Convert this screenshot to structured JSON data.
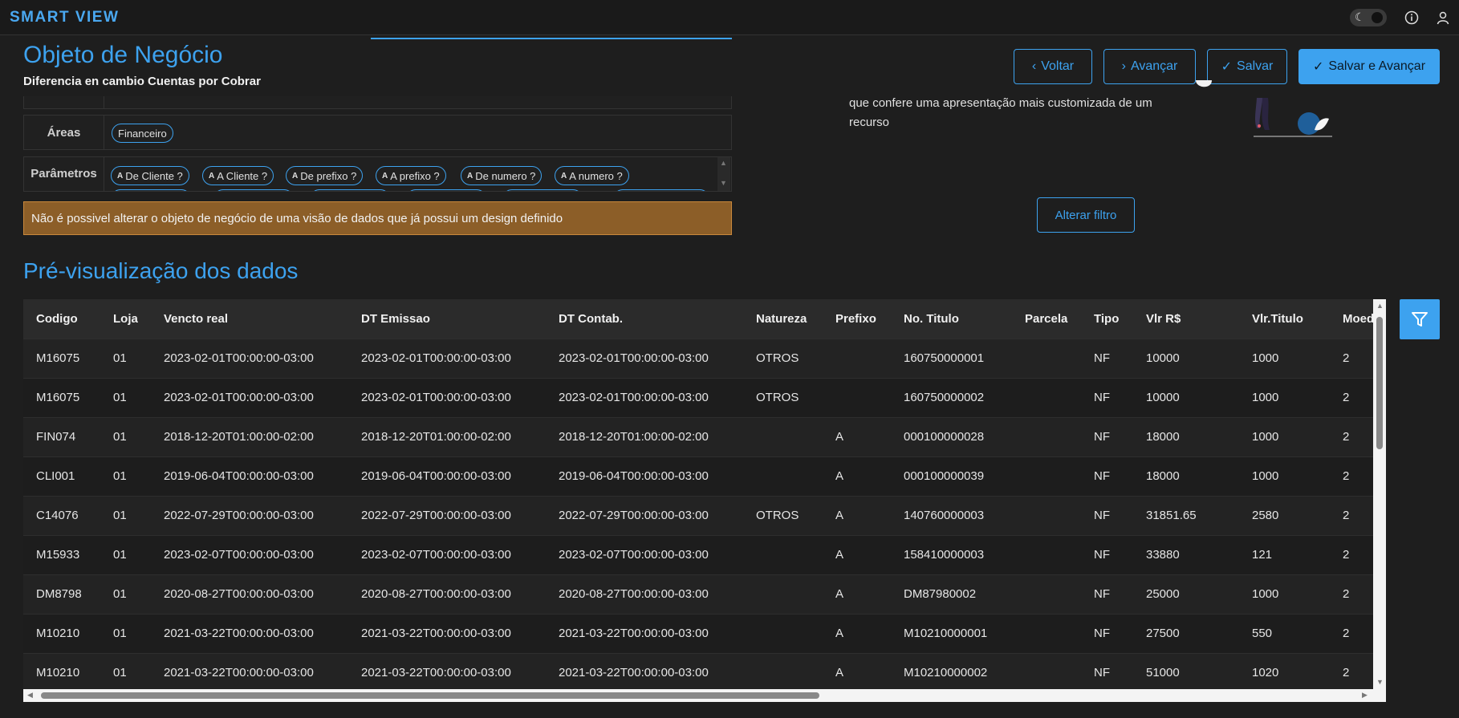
{
  "app": {
    "brand": "SMART VIEW"
  },
  "header": {
    "title": "Objeto de Negócio",
    "subtitle": "Diferencia en cambio Cuentas por Cobrar"
  },
  "actions": {
    "back": "Voltar",
    "next": "Avançar",
    "save": "Salvar",
    "save_next": "Salvar e Avançar"
  },
  "areas": {
    "label": "Áreas",
    "items": [
      "Financeiro"
    ]
  },
  "parametros": {
    "label": "Parâmetros",
    "items": [
      "De Cliente ?",
      "A Cliente ?",
      "De prefixo ?",
      "A prefixo ?",
      "De numero ?",
      "A numero ?"
    ]
  },
  "warning": "Não é possivel alterar o objeto de negócio de uma visão de dados que já possui um design definido",
  "helper": {
    "text": "que confere uma apresentação mais customizada de um recurso"
  },
  "alter_filter": "Alterar filtro",
  "preview": {
    "title": "Pré-visualização dos dados",
    "columns": [
      "Codigo",
      "Loja",
      "Vencto real",
      "DT Emissao",
      "DT Contab.",
      "Natureza",
      "Prefixo",
      "No. Titulo",
      "Parcela",
      "Tipo",
      "Vlr R$",
      "Vlr.Titulo",
      "Moeda"
    ],
    "rows": [
      [
        "M16075",
        "01",
        "2023-02-01T00:00:00-03:00",
        "2023-02-01T00:00:00-03:00",
        "2023-02-01T00:00:00-03:00",
        "OTROS",
        "",
        "160750000001",
        "",
        "NF",
        "10000",
        "1000",
        "2"
      ],
      [
        "M16075",
        "01",
        "2023-02-01T00:00:00-03:00",
        "2023-02-01T00:00:00-03:00",
        "2023-02-01T00:00:00-03:00",
        "OTROS",
        "",
        "160750000002",
        "",
        "NF",
        "10000",
        "1000",
        "2"
      ],
      [
        "FIN074",
        "01",
        "2018-12-20T01:00:00-02:00",
        "2018-12-20T01:00:00-02:00",
        "2018-12-20T01:00:00-02:00",
        "",
        "A",
        "000100000028",
        "",
        "NF",
        "18000",
        "1000",
        "2"
      ],
      [
        "CLI001",
        "01",
        "2019-06-04T00:00:00-03:00",
        "2019-06-04T00:00:00-03:00",
        "2019-06-04T00:00:00-03:00",
        "",
        "A",
        "000100000039",
        "",
        "NF",
        "18000",
        "1000",
        "2"
      ],
      [
        "C14076",
        "01",
        "2022-07-29T00:00:00-03:00",
        "2022-07-29T00:00:00-03:00",
        "2022-07-29T00:00:00-03:00",
        "OTROS",
        "A",
        "140760000003",
        "",
        "NF",
        "31851.65",
        "2580",
        "2"
      ],
      [
        "M15933",
        "01",
        "2023-02-07T00:00:00-03:00",
        "2023-02-07T00:00:00-03:00",
        "2023-02-07T00:00:00-03:00",
        "",
        "A",
        "158410000003",
        "",
        "NF",
        "33880",
        "121",
        "2"
      ],
      [
        "DM8798",
        "01",
        "2020-08-27T00:00:00-03:00",
        "2020-08-27T00:00:00-03:00",
        "2020-08-27T00:00:00-03:00",
        "",
        "A",
        "DM87980002",
        "",
        "NF",
        "25000",
        "1000",
        "2"
      ],
      [
        "M10210",
        "01",
        "2021-03-22T00:00:00-03:00",
        "2021-03-22T00:00:00-03:00",
        "2021-03-22T00:00:00-03:00",
        "",
        "A",
        "M10210000001",
        "",
        "NF",
        "27500",
        "550",
        "2"
      ],
      [
        "M10210",
        "01",
        "2021-03-22T00:00:00-03:00",
        "2021-03-22T00:00:00-03:00",
        "2021-03-22T00:00:00-03:00",
        "",
        "A",
        "M10210000002",
        "",
        "NF",
        "51000",
        "1020",
        "2"
      ]
    ]
  },
  "icons": {
    "theme": "moon-icon",
    "info": "info-icon",
    "user": "user-icon",
    "filter": "filter-icon",
    "back": "chevron-left-icon",
    "next": "chevron-right-icon",
    "save": "check-icon"
  },
  "colors": {
    "accent": "#3da2ef",
    "warning_bg": "#8c5e28",
    "background": "#1e1e1e"
  }
}
